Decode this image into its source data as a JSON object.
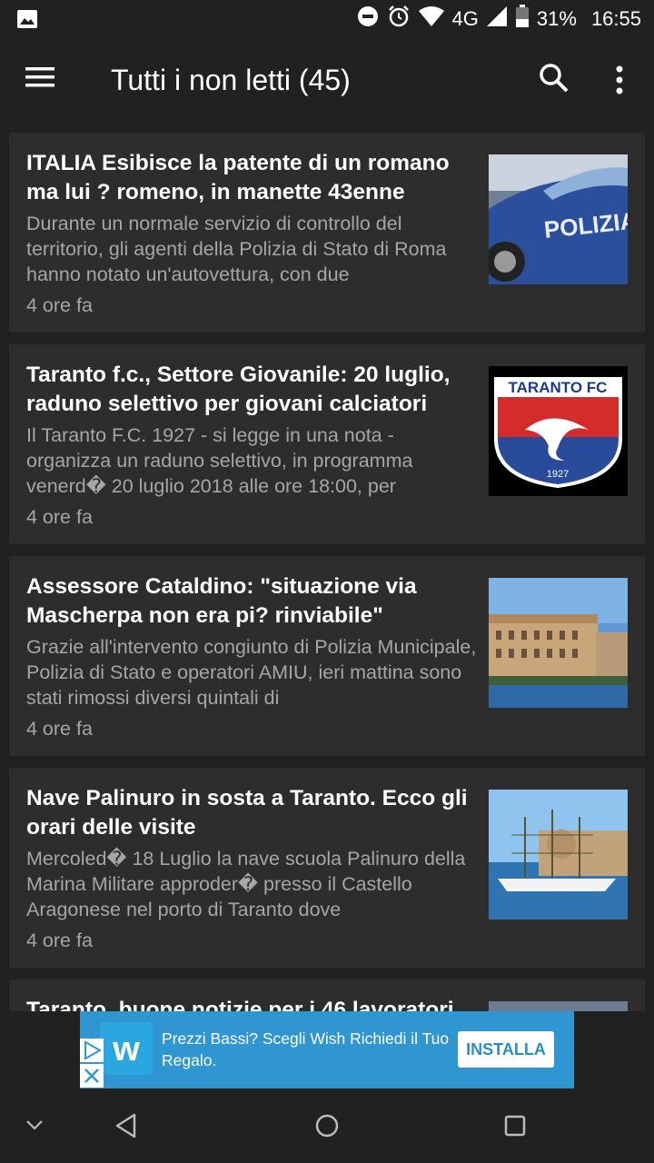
{
  "status_bar": {
    "network": "4G",
    "battery": "31%",
    "time": "16:55",
    "icons": [
      "image-icon",
      "dnd-icon",
      "alarm-icon",
      "wifi-icon",
      "signal-icon",
      "battery-icon"
    ]
  },
  "app_bar": {
    "title": "Tutti i non letti (45)",
    "icons": [
      "menu-icon",
      "search-icon",
      "more-vert-icon"
    ]
  },
  "articles": [
    {
      "title": "ITALIA Esibisce la patente di un romano ma lui ? romeno, in manette 43enne",
      "body": "Durante un normale servizio di controllo del territorio, gli agenti della Polizia di Stato di Roma hanno notato un'autovettura, con due",
      "time": "4 ore fa",
      "thumb_text": "POLIZIA"
    },
    {
      "title": "Taranto f.c., Settore Giovanile: 20 luglio, raduno selettivo per giovani calciatori",
      "body": "Il Taranto F.C. 1927 - si legge in una nota - organizza un raduno selettivo, in programma venerd� 20 luglio 2018 alle ore 18:00, per",
      "time": "4 ore fa",
      "thumb_text": "TARANTO FC",
      "thumb_year": "1927"
    },
    {
      "title": "Assessore Cataldino: \"situazione via Mascherpa non era pi? rinviabile\"",
      "body": "Grazie all'intervento congiunto di Polizia Municipale, Polizia di Stato e operatori AMIU, ieri mattina sono stati rimossi diversi quintali di",
      "time": "4 ore fa"
    },
    {
      "title": "Nave Palinuro in sosta a Taranto. Ecco gli orari delle visite",
      "body": "Mercoled� 18 Luglio la nave scuola Palinuro della Marina Militare approder� presso il Castello Aragonese nel porto di Taranto dove",
      "time": "4 ore fa"
    },
    {
      "title": "Taranto, buone notizie per i 46 lavoratori",
      "body": "",
      "time": ""
    }
  ],
  "ad": {
    "text": "Prezzi Bassi? Scegli Wish Richiedi il Tuo Regalo.",
    "cta": "INSTALLA",
    "logo_letter": "w"
  },
  "nav_bar": {
    "icons": [
      "chevron-down-icon",
      "back-icon",
      "home-icon",
      "recents-icon"
    ]
  },
  "colors": {
    "background": "#212121",
    "card": "#2d2d2d",
    "secondary_text": "#a6a6a6",
    "ad_background": "#2f96d1"
  }
}
